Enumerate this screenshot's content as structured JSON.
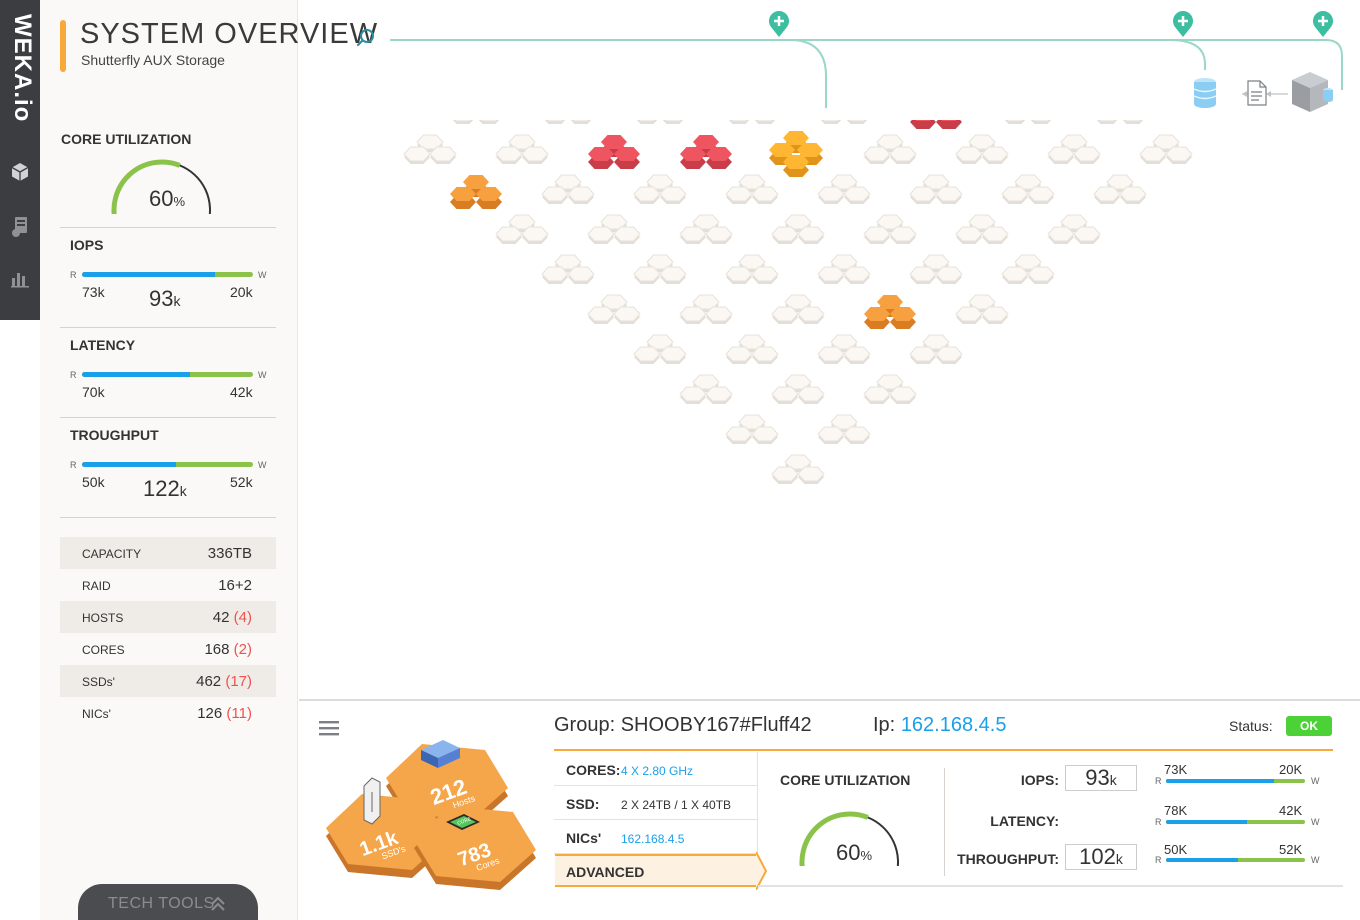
{
  "brand": {
    "logo_text": "WEKA.io"
  },
  "header": {
    "title": "SYSTEM OVERVIEW",
    "subtitle": "Shutterfly AUX Storage"
  },
  "sidebar": {
    "core_utilization": {
      "label": "CORE UTILIZATION",
      "value": "60",
      "unit": "%",
      "fraction": 0.6
    },
    "iops": {
      "label": "IOPS",
      "r_label": "R",
      "w_label": "W",
      "read": "73k",
      "write": "20k",
      "total": "93",
      "total_unit": "k",
      "read_fraction": 0.78
    },
    "latency": {
      "label": "LATENCY",
      "r_label": "R",
      "w_label": "W",
      "read": "70k",
      "write": "42k",
      "read_fraction": 0.63
    },
    "throughput": {
      "label": "TROUGHPUT",
      "r_label": "R",
      "w_label": "W",
      "read": "50k",
      "write": "52k",
      "total": "122",
      "total_unit": "k",
      "read_fraction": 0.55
    },
    "stats": [
      {
        "label": "CAPACITY",
        "value": "336TB",
        "error": ""
      },
      {
        "label": "RAID",
        "value": "16+2",
        "error": ""
      },
      {
        "label": "HOSTS",
        "value": "42",
        "error": "4"
      },
      {
        "label": "CORES",
        "value": "168",
        "error": "2"
      },
      {
        "label": "SSDs'",
        "value": "462",
        "error": "17"
      },
      {
        "label": "NICs'",
        "value": "126",
        "error": "11"
      }
    ],
    "tech_tools": "TECH TOOLS"
  },
  "colors": {
    "accent": "#f7a93b",
    "read": "#1aa0e8",
    "write": "#8bc34a",
    "error": "#ef5350",
    "ok": "#4cd137",
    "teal": "#3dbea0",
    "hex_idle": "#fbf7f3",
    "hex_warn": "#f7a040",
    "hex_crit": "#ef5560",
    "hex_selected": "#ffb733"
  },
  "map": {
    "rows": 9,
    "cols": 9,
    "cells": [
      [
        "idle",
        "idle",
        "idle",
        "idle",
        "idle",
        "idle",
        "idle",
        "idle",
        "idle"
      ],
      [
        "warn",
        "idle",
        "idle",
        "idle",
        "idle",
        "idle",
        "idle",
        "idle",
        "idle"
      ],
      [
        "idle",
        "idle",
        "crit",
        "idle",
        "idle",
        "warn",
        "idle",
        "idle",
        "idle"
      ],
      [
        "idle",
        "idle",
        "idle",
        "crit",
        "idle",
        "idle",
        "idle",
        "idle",
        "idle"
      ],
      [
        "idle",
        "idle",
        "idle",
        "idle",
        "selected",
        "idle",
        "idle",
        "idle",
        "idle"
      ],
      [
        "idle",
        "idle",
        "idle",
        "idle",
        "idle",
        "idle",
        "crit",
        "idle",
        "idle"
      ],
      [
        "idle",
        "idle",
        "idle",
        "idle",
        "idle",
        "idle",
        "idle",
        "idle",
        "idle"
      ],
      [
        "idle",
        "idle",
        "idle",
        "warn",
        "idle",
        "idle",
        "idle",
        "idle",
        "idle"
      ],
      [
        "idle",
        "idle",
        "idle",
        "idle",
        "idle",
        "idle",
        "idle",
        "idle",
        "idle"
      ]
    ],
    "add_buttons": [
      "+",
      "+",
      "+"
    ]
  },
  "detail": {
    "group_label": "Group:",
    "group_value": "SHOOBY167#Fluff42",
    "ip_label": "Ip:",
    "ip_value": "162.168.4.5",
    "status_label": "Status:",
    "status_value": "OK",
    "hexes": {
      "hosts_value": "212",
      "hosts_label": "Hosts",
      "ssds_value": "1.1k",
      "ssds_label": "SSD's",
      "cores_value": "783",
      "cores_label": "Cores",
      "chip_label": "CORE"
    },
    "rows": [
      {
        "key": "CORES:",
        "value": "4 X 2.80 GHz",
        "link": true
      },
      {
        "key": "SSD:",
        "value": "2 X 24TB / 1 X 40TB",
        "link": false
      },
      {
        "key": "NICs'",
        "value": "162.168.4.5",
        "link": true
      }
    ],
    "advanced": "ADVANCED",
    "core_utilization": {
      "label": "CORE UTILIZATION",
      "value": "60",
      "unit": "%",
      "fraction": 0.6
    },
    "metrics": {
      "iops": {
        "label": "IOPS:",
        "value": "93",
        "unit": "k",
        "read": "73K",
        "write": "20K",
        "read_fraction": 0.78
      },
      "latency": {
        "label": "LATENCY:",
        "read": "78K",
        "write": "42K",
        "read_fraction": 0.58
      },
      "throughput": {
        "label": "THROUGHPUT:",
        "value": "102",
        "unit": "k",
        "read": "50K",
        "write": "52K",
        "read_fraction": 0.52
      },
      "r_label": "R",
      "w_label": "W"
    }
  }
}
